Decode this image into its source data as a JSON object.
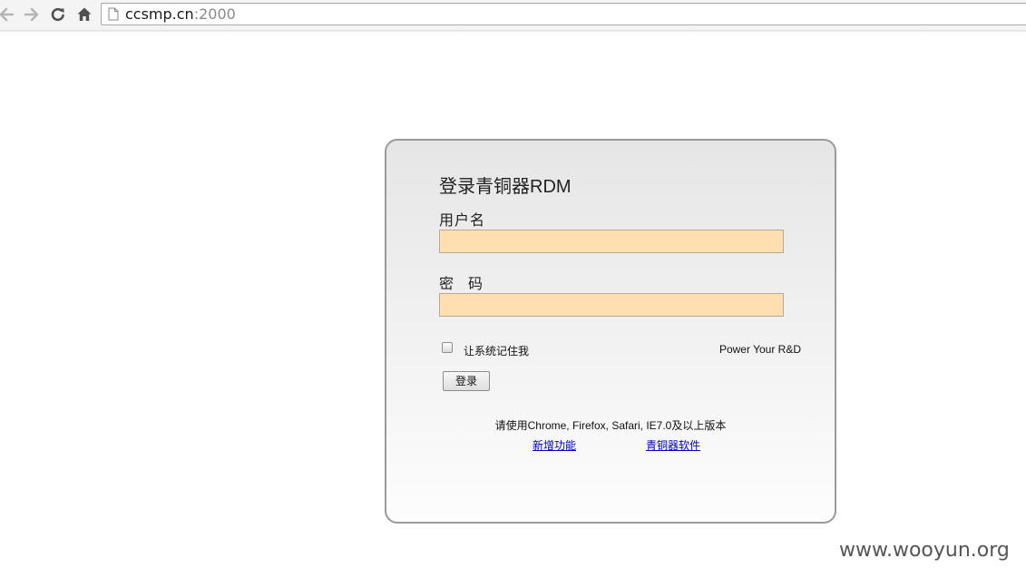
{
  "browser": {
    "url_host": "ccsmp.cn",
    "url_port": ":2000",
    "icons": {
      "back": "arrow-left-icon",
      "forward": "arrow-right-icon",
      "reload": "reload-icon",
      "home": "home-icon",
      "page": "page-icon"
    }
  },
  "login": {
    "title": "登录青铜器RDM",
    "username_label": "用户名",
    "username_value": "",
    "password_label": "密　码",
    "password_value": "",
    "remember_label": "让系统记住我",
    "remember_checked": false,
    "power_text": "Power Your R&D",
    "submit_label": "登录",
    "browser_note": "请使用Chrome, Firefox, Safari, IE7.0及以上版本",
    "links": {
      "new_features": "新增功能",
      "software": "青铜器软件"
    }
  },
  "watermark": "www.wooyun.org",
  "colors": {
    "input_background": "#ffdfb0",
    "panel_border": "#9a9a9a",
    "link": "#0000cc"
  }
}
